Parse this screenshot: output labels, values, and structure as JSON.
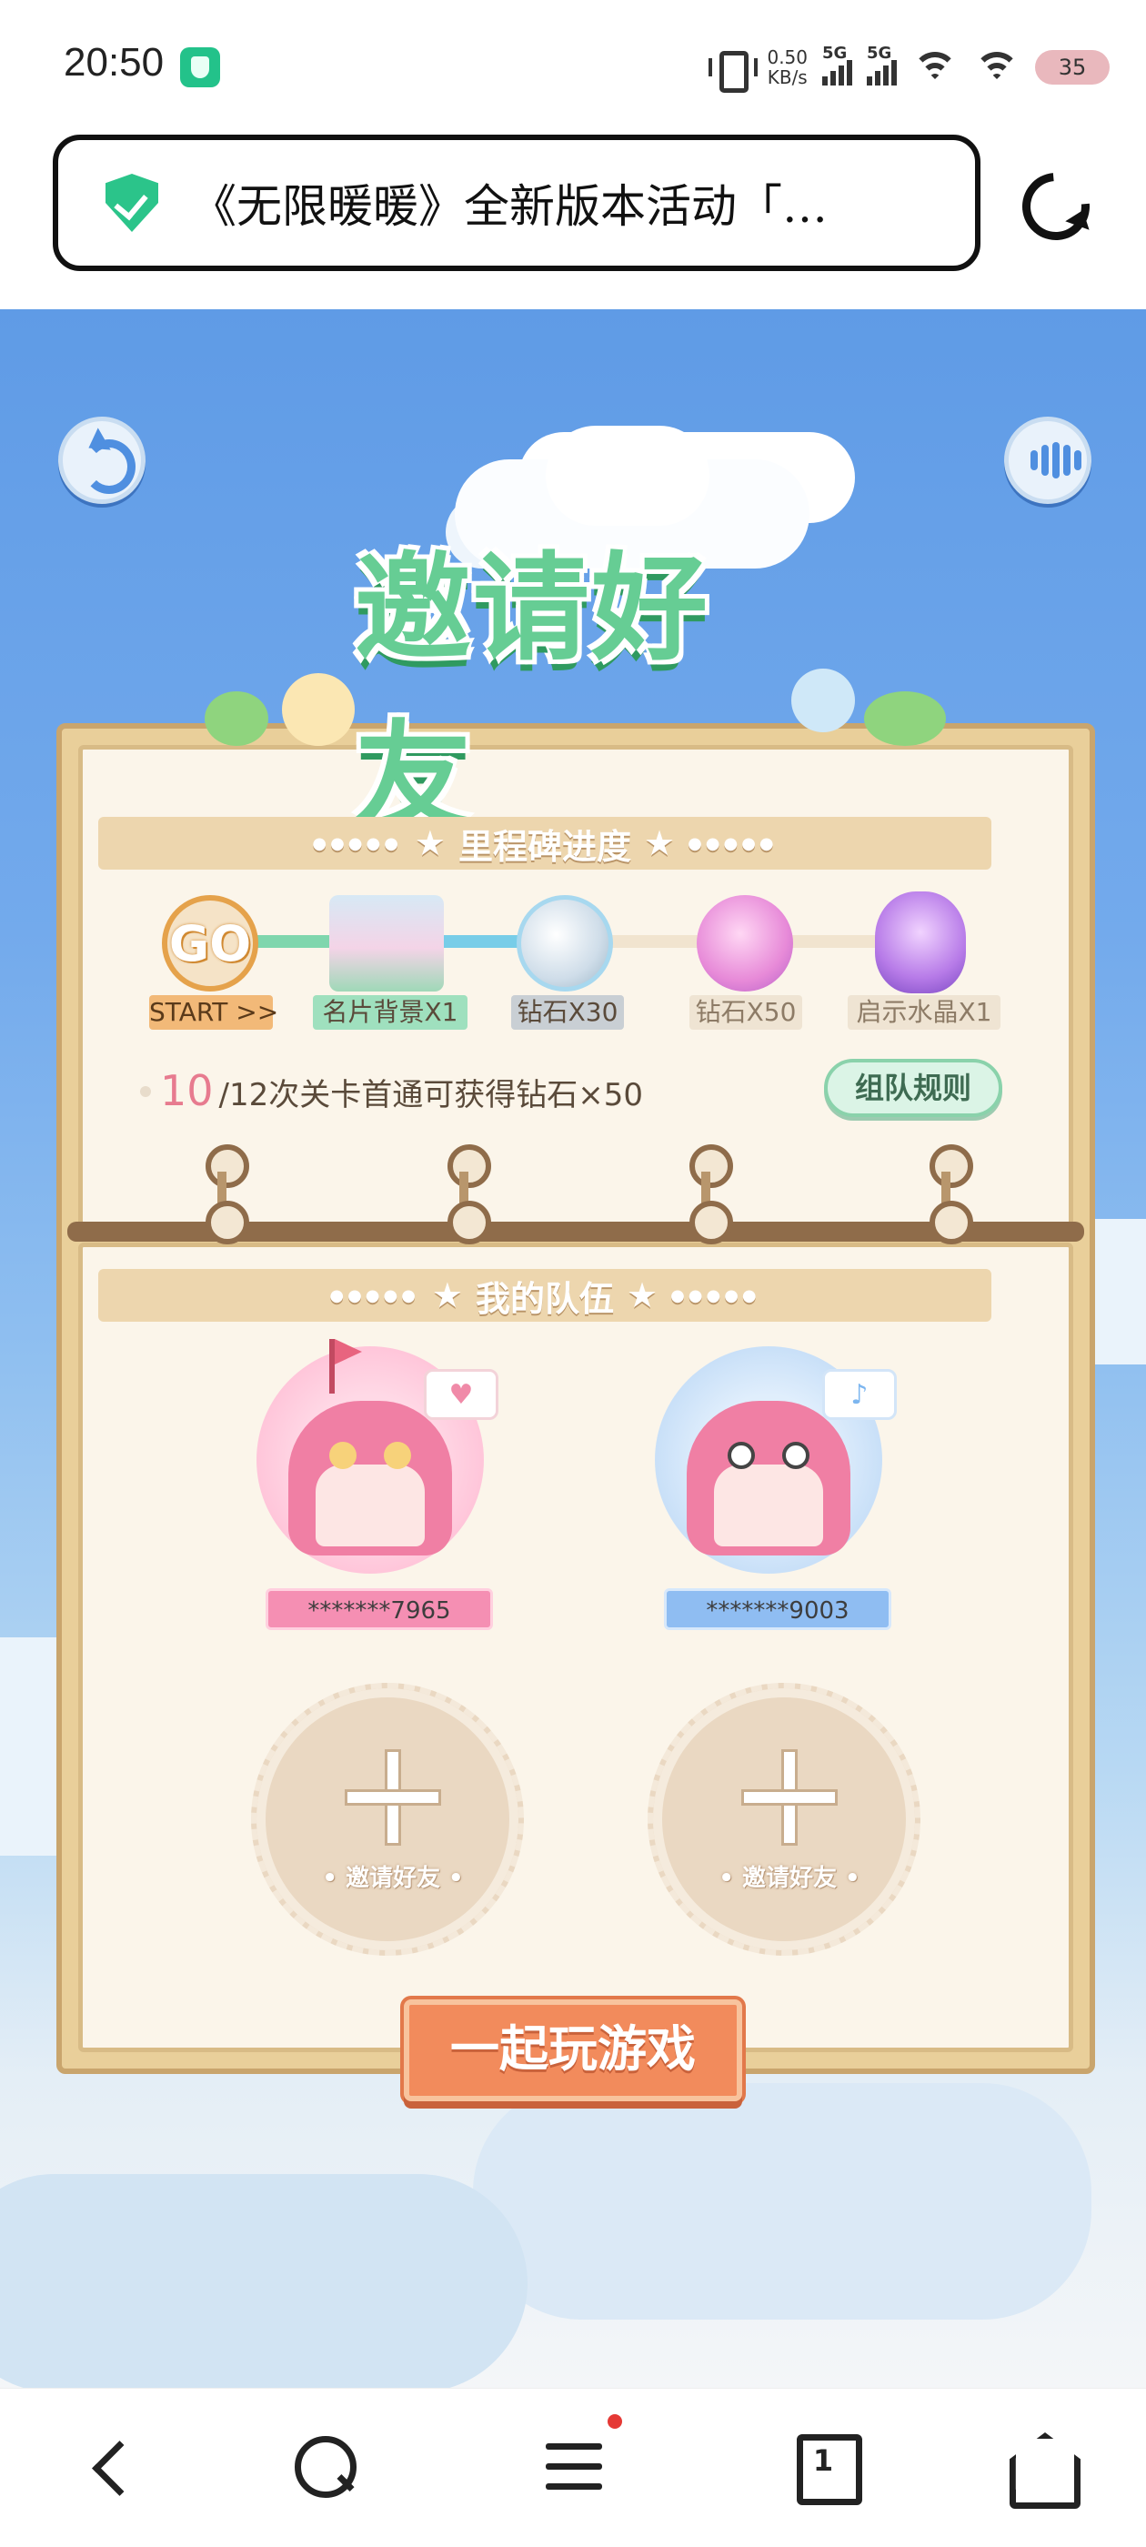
{
  "status_bar": {
    "time": "20:50",
    "net_speed_value": "0.50",
    "net_speed_unit": "KB/s",
    "sim1": "5G",
    "sim2": "5G",
    "battery": "35"
  },
  "browser": {
    "page_title": "《无限暖暖》全新版本活动「…",
    "secure_icon": "shield-check-icon",
    "reload_icon": "reload-icon"
  },
  "game": {
    "title": "邀请好友",
    "milestones_heading": "里程碑进度",
    "milestones": [
      {
        "node": "GO",
        "label": "START >>"
      },
      {
        "label": "名片背景X1"
      },
      {
        "label": "钻石X30"
      },
      {
        "label": "钻石X50"
      },
      {
        "label": "启示水晶X1"
      }
    ],
    "progress": {
      "current": "10",
      "rest": "/12次关卡首通可获得钻石×50"
    },
    "rule_button": "组队规则",
    "team_heading": "我的队伍",
    "members": [
      {
        "name": "*******7965",
        "tag": "♥"
      },
      {
        "name": "*******9003",
        "tag": "♪"
      }
    ],
    "invite_label": "• 邀请好友 •",
    "play_button": "一起玩游戏"
  },
  "nav": {
    "tabs_count": "1"
  }
}
